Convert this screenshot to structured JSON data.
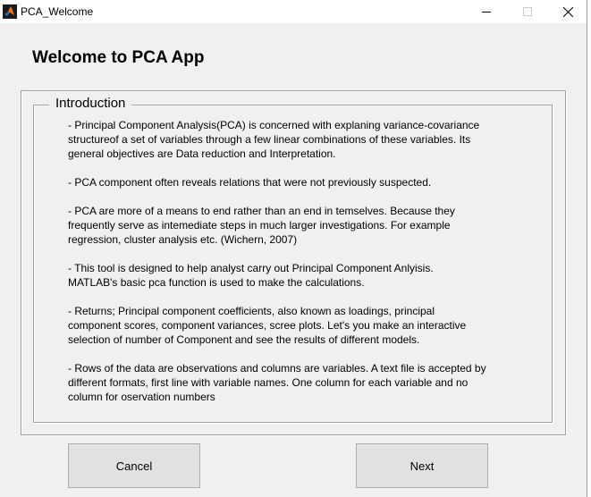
{
  "window": {
    "title": "PCA_Welcome"
  },
  "heading": "Welcome to PCA App",
  "group": {
    "title": "Introduction",
    "paragraphs": [
      " - Principal Component Analysis(PCA) is concerned with explaning variance-covariance\nstructureof a set of variables through a few linear combinations of these variables.  Its\ngeneral objectives are Data reduction and Interpretation.",
      " - PCA component often reveals relations that were not previously suspected.",
      " - PCA are more of a means to end rather than an end in temselves. Because they\nfrequently serve as intemediate steps in much larger investigations. For example\nregression, cluster analysis etc. (Wichern, 2007)",
      " - This tool is designed to help analyst carry out Principal Component Anlyisis.\nMATLAB's basic pca function is used to make the calculations.",
      " - Returns; Principal component coefficients, also known as loadings, principal\ncomponent scores, component variances, scree plots. Let's you make an interactive\nselection of number of Component and see the results of different models.",
      " - Rows of the data are observations and columns are variables. A text file is accepted by\ndifferent formats, first line with variable names. One column for each variable and no\ncolumn for oservation numbers"
    ]
  },
  "buttons": {
    "cancel": "Cancel",
    "next": "Next"
  },
  "icons": {
    "app": "matlab-icon",
    "minimize": "minimize-icon",
    "maximize": "maximize-icon",
    "close": "close-icon"
  },
  "colors": {
    "window_bg": "#f0f0f0",
    "button_bg": "#e1e1e1",
    "border": "#a0a0a0"
  }
}
